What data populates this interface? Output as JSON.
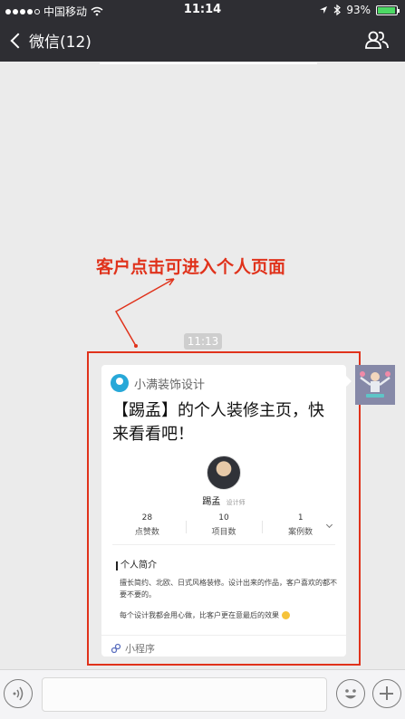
{
  "status_bar": {
    "carrier": "中国移动",
    "time": "11:14",
    "battery": "93%"
  },
  "nav": {
    "back_label": "微信(12)"
  },
  "chat": {
    "timestamp": "11:13"
  },
  "annotation": {
    "text": "客户点击可进入个人页面",
    "color": "#e0321b"
  },
  "card": {
    "app_name": "小满装饰设计",
    "title": "【踢孟】的个人装修主页，快来看看吧！",
    "designer": {
      "name": "踢孟",
      "role": "设计师"
    },
    "stats": [
      {
        "value": "28",
        "label": "点赞数"
      },
      {
        "value": "10",
        "label": "项目数"
      },
      {
        "value": "1",
        "label": "案例数"
      }
    ],
    "intro_heading": "个人简介",
    "intro_body": "擅长简约、北欧、日式风格装修。设计出来的作品，客户喜欢的都不要不要的。",
    "intro_body2": "每个设计我都会用心做，比客户更在意最后的效果",
    "footer_label": "小程序"
  },
  "colors": {
    "nav_background": "#2e2e33",
    "chat_background": "#ebebeb",
    "battery_fill": "#4cd964"
  }
}
